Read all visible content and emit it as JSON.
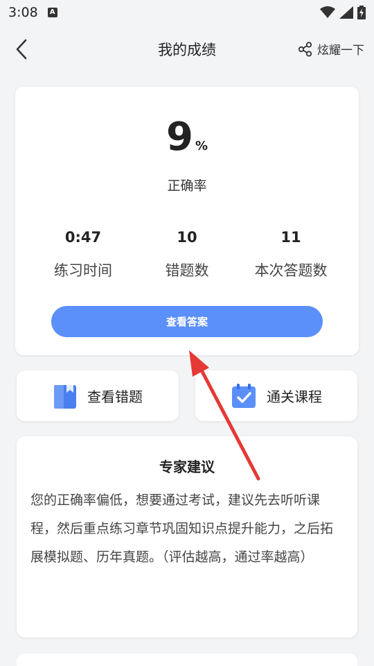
{
  "status_bar": {
    "time": "3:08",
    "notif": "A"
  },
  "nav": {
    "title": "我的成绩",
    "share_label": "炫耀一下"
  },
  "score": {
    "value": "9",
    "unit": "%",
    "label": "正确率"
  },
  "stats": [
    {
      "value": "0:47",
      "label": "练习时间"
    },
    {
      "value": "10",
      "label": "错题数"
    },
    {
      "value": "11",
      "label": "本次答题数"
    }
  ],
  "view_answers_label": "查看答案",
  "actions": {
    "wrong_questions_label": "查看错题",
    "course_label": "通关课程"
  },
  "advice": {
    "title": "专家建议",
    "body": "您的正确率偏低，想要通过考试，建议先去听听课程，然后重点练习章节巩固知识点提升能力，之后拓展模拟题、历年真题。（评估越高，通过率越高）"
  },
  "colors": {
    "accent": "#5b8ff9",
    "annotation_arrow": "#e53935"
  }
}
